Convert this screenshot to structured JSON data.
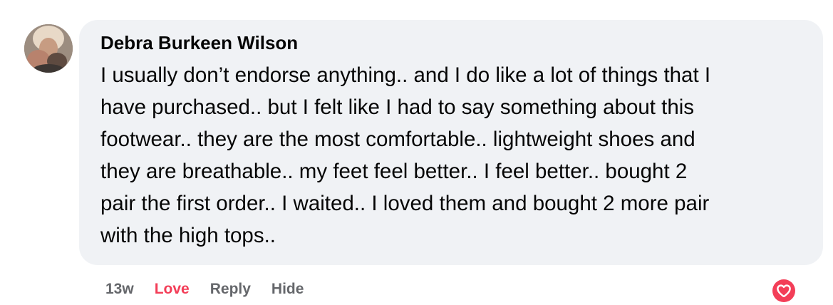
{
  "comment": {
    "author": "Debra Burkeen Wilson",
    "lines": [
      "I usually don’t endorse anything.. and I do like a lot of things that I",
      "have purchased.. but I felt like I had to say something about this",
      "footwear.. they are the most comfortable.. lightweight shoes and",
      "they are breathable.. my feet feel better.. I feel better.. bought 2",
      "pair the first order.. I waited.. I loved them and bought 2 more pair",
      "with the high tops.."
    ],
    "timestamp": "13w",
    "actions": {
      "love": "Love",
      "reply": "Reply",
      "hide": "Hide"
    },
    "reaction_icon": "heart-reaction-icon",
    "colors": {
      "bubble_bg": "#f0f2f5",
      "love": "#f33e58",
      "muted": "#65676b"
    }
  }
}
